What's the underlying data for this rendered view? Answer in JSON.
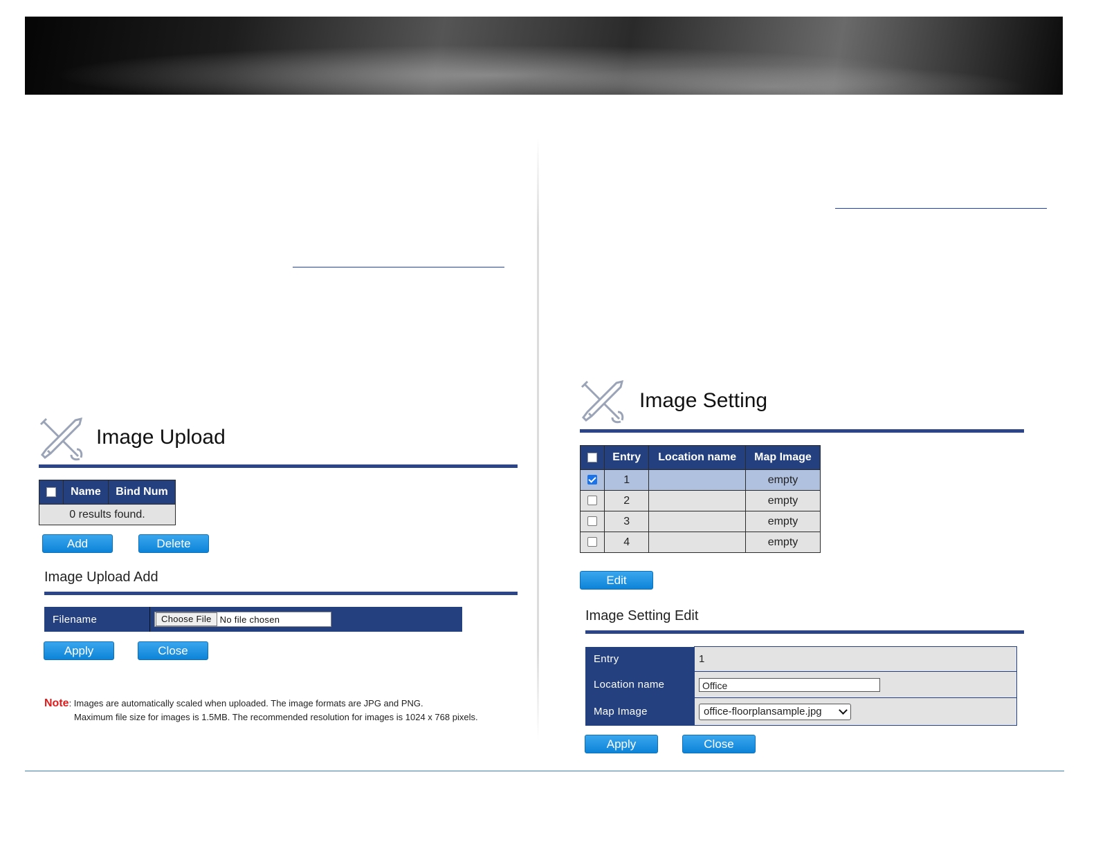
{
  "left": {
    "title": "Image Upload",
    "table": {
      "headers": [
        "Name",
        "Bind Num"
      ],
      "empty_message": "0 results found."
    },
    "buttons": {
      "add": "Add",
      "delete": "Delete"
    },
    "add_section": {
      "title": "Image Upload Add",
      "filename_label": "Filename",
      "file_button": "Choose File",
      "file_status": "No file chosen",
      "apply": "Apply",
      "close": "Close"
    },
    "note": {
      "label": "Note",
      "line1": ": Images are automatically scaled when uploaded. The image formats are JPG and PNG.",
      "line2": "Maximum file size for images is 1.5MB. The recommended resolution for images is 1024 x 768 pixels."
    }
  },
  "right": {
    "title": "Image Setting",
    "table": {
      "headers": [
        "Entry",
        "Location name",
        "Map Image"
      ],
      "rows": [
        {
          "entry": "1",
          "location": "",
          "map": "empty",
          "checked": true
        },
        {
          "entry": "2",
          "location": "",
          "map": "empty",
          "checked": false
        },
        {
          "entry": "3",
          "location": "",
          "map": "empty",
          "checked": false
        },
        {
          "entry": "4",
          "location": "",
          "map": "empty",
          "checked": false
        }
      ]
    },
    "buttons": {
      "edit": "Edit"
    },
    "edit_section": {
      "title": "Image Setting Edit",
      "entry_label": "Entry",
      "entry_value": "1",
      "location_label": "Location name",
      "location_value": "Office",
      "map_label": "Map Image",
      "map_value": "office-floorplansample.jpg",
      "apply": "Apply",
      "close": "Close"
    }
  },
  "colors": {
    "header_navy": "#24407e",
    "rule_navy": "#2b4588",
    "button_blue": "#0d84d8",
    "selected_row": "#b0c1e0",
    "note_red": "#e01b1b"
  },
  "icons": [
    "tools-icon",
    "checkbox-icon",
    "chevron-down-icon"
  ]
}
